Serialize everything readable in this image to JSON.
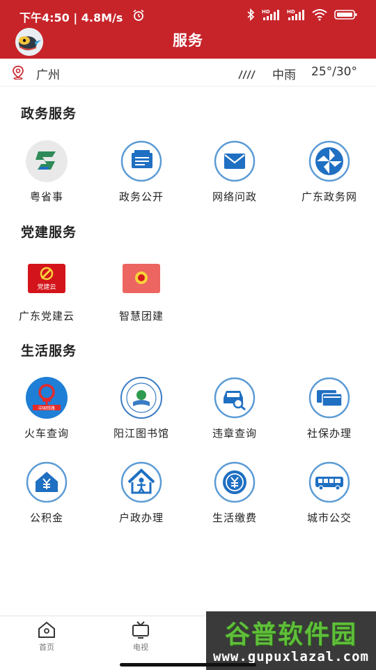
{
  "status_bar": {
    "time_speed": "下午4:50 | 4.8M/s",
    "sim1": "HD",
    "sim2": "HD"
  },
  "header": {
    "title": "服务"
  },
  "location": {
    "city": "广州",
    "weather": "中雨",
    "temperature": "25°/30°"
  },
  "sections": [
    {
      "title": "政务服务",
      "items": [
        {
          "label": "粤省事",
          "icon": "yueshengshi-icon"
        },
        {
          "label": "政务公开",
          "icon": "document-icon"
        },
        {
          "label": "网络问政",
          "icon": "mail-icon"
        },
        {
          "label": "广东政务网",
          "icon": "pinwheel-icon"
        }
      ]
    },
    {
      "title": "党建服务",
      "items": [
        {
          "label": "广东党建云",
          "icon": "party-cloud-icon",
          "icon_text": "党建云"
        },
        {
          "label": "智慧团建",
          "icon": "youth-league-icon"
        }
      ]
    },
    {
      "title": "生活服务",
      "items": [
        {
          "label": "火车查询",
          "icon": "china-railway-icon",
          "icon_text": "中国铁路"
        },
        {
          "label": "阳江图书馆",
          "icon": "library-icon"
        },
        {
          "label": "违章查询",
          "icon": "car-search-icon"
        },
        {
          "label": "社保办理",
          "icon": "cards-icon"
        },
        {
          "label": "公积金",
          "icon": "house-yuan-icon"
        },
        {
          "label": "户政办理",
          "icon": "house-person-icon"
        },
        {
          "label": "生活缴费",
          "icon": "coin-yuan-icon"
        },
        {
          "label": "城市公交",
          "icon": "bus-icon"
        }
      ]
    }
  ],
  "bottom_nav": [
    {
      "label": "首页",
      "icon": "home-icon"
    },
    {
      "label": "电视",
      "icon": "tv-icon"
    }
  ],
  "watermark": {
    "logo_text": "谷普软件园",
    "url": "www.gupuxlazal.com"
  },
  "colors": {
    "brand_red": "#c7242a",
    "icon_blue": "#1f6fc2",
    "icon_ring": "#5b9bd5"
  }
}
